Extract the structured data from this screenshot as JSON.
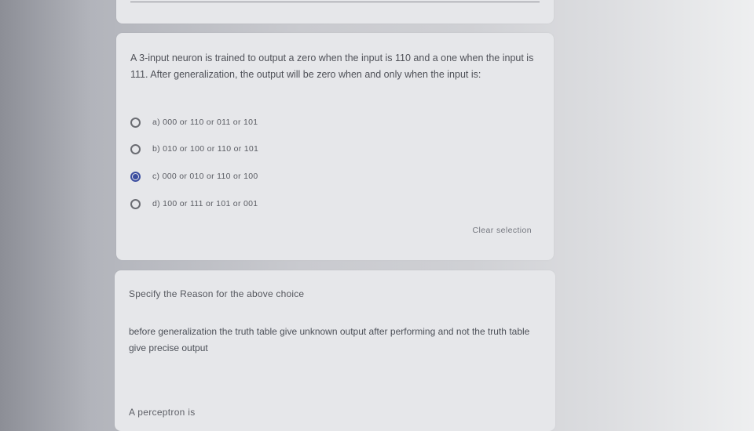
{
  "question": {
    "text": "A 3-input neuron is trained to output a zero when the input is 110 and a one when the input is 111. After generalization, the output will be zero when and only when the input is:",
    "options": [
      {
        "label": "a) 000 or 110 or 011 or 101",
        "selected": false
      },
      {
        "label": "b) 010 or 100 or 110 or 101",
        "selected": false
      },
      {
        "label": "c) 000 or 010 or 110 or 100",
        "selected": true
      },
      {
        "label": "d) 100 or 111 or 101 or 001",
        "selected": false
      }
    ],
    "clear_label": "Clear selection"
  },
  "reason": {
    "title": "Specify the Reason for the above choice",
    "answer": "before generalization the truth table give unknown output after performing and not the truth table give precise output"
  },
  "next": {
    "title": "A perceptron is"
  },
  "colors": {
    "accent": "#3c4ea0",
    "card": "#e6e7ea"
  }
}
